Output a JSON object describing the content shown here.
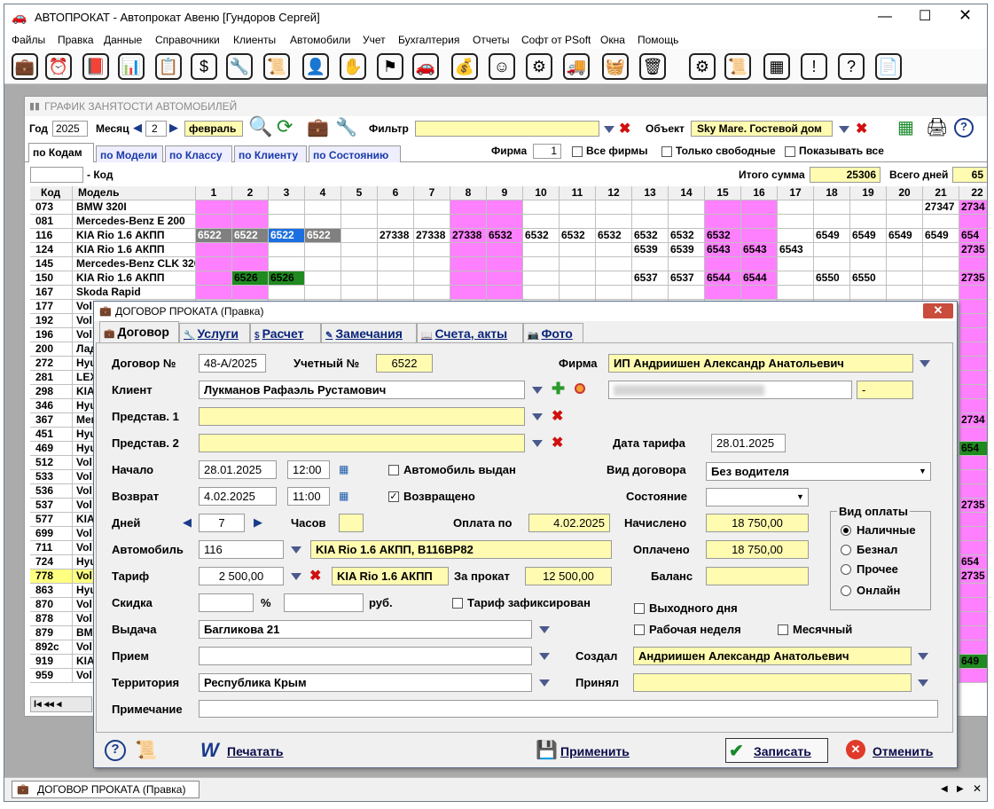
{
  "window": {
    "title": "АВТОПРОКАТ - Автопрокат Авеню  [Гундоров Сергей]"
  },
  "menu": [
    "Файлы",
    "Правка",
    "Данные",
    "Справочники",
    "Клиенты",
    "Автомобили",
    "Учет",
    "Бухгалтерия",
    "Отчеты",
    "Софт от PSoft",
    "Окна",
    "Помощь"
  ],
  "toolbar_icons": [
    "briefcase-icon",
    "alarm-clock-icon",
    "book-icon",
    "chart-icon",
    "clipboard-icon",
    "money-icon",
    "wrench-icon",
    "scroll-icon",
    "person-icon",
    "stop-hand-icon",
    "flag-icon",
    "car-icon",
    "money-bag-icon",
    "face-icon",
    "gear-icon",
    "truck-icon",
    "basket-icon",
    "trash-icon",
    "settings-doc-icon",
    "scroll2-icon",
    "calculator-icon",
    "warning-icon",
    "help-icon",
    "document-icon"
  ],
  "schedule": {
    "title": "ГРАФИК ЗАНЯТОСТИ АВТОМОБИЛЕЙ",
    "year_label": "Год",
    "year": "2025",
    "month_label": "Месяц",
    "month_num": "2",
    "month_name": "февраль",
    "filter_label": "Фильтр",
    "object_label": "Объект",
    "object": "Sky Mare. Гостевой дом",
    "tabs": [
      "по Кодам",
      "по Модели",
      "по Классу",
      "по Клиенту",
      "по Состоянию"
    ],
    "firm_label": "Фирма",
    "firm_value": "1",
    "all_firms": "Все фирмы",
    "only_free": "Только свободные",
    "show_all": "Показывать все",
    "code_label": "- Код",
    "total_sum_label": "Итого сумма",
    "total_sum": "25306",
    "total_days_label": "Всего дней",
    "total_days": "65",
    "col_code": "Код",
    "col_model": "Модель",
    "days": [
      "1",
      "2",
      "3",
      "4",
      "5",
      "6",
      "7",
      "8",
      "9",
      "10",
      "11",
      "12",
      "13",
      "14",
      "15",
      "16",
      "17",
      "18",
      "19",
      "20",
      "21",
      "22"
    ],
    "rows": [
      {
        "code": "073",
        "model": "BMW 320I"
      },
      {
        "code": "081",
        "model": "Mercedes-Benz E 200"
      },
      {
        "code": "116",
        "model": "KIA Rio 1.6 АКПП"
      },
      {
        "code": "124",
        "model": "KIA Rio 1.6 АКПП"
      },
      {
        "code": "145",
        "model": "Mercedes-Benz CLK 320"
      },
      {
        "code": "150",
        "model": "KIA Rio 1.6 АКПП"
      },
      {
        "code": "167",
        "model": "Skoda Rapid"
      },
      {
        "code": "177",
        "model": "Vol"
      },
      {
        "code": "192",
        "model": "Vol"
      },
      {
        "code": "196",
        "model": "Vol"
      },
      {
        "code": "200",
        "model": "Лад"
      },
      {
        "code": "272",
        "model": "Hyu"
      },
      {
        "code": "281",
        "model": "LEX"
      },
      {
        "code": "298",
        "model": "KIA"
      },
      {
        "code": "346",
        "model": "Hyu"
      },
      {
        "code": "367",
        "model": "Mer"
      },
      {
        "code": "451",
        "model": "Hyu"
      },
      {
        "code": "469",
        "model": "Hyu"
      },
      {
        "code": "512",
        "model": "Vol"
      },
      {
        "code": "533",
        "model": "Vol"
      },
      {
        "code": "536",
        "model": "Vol"
      },
      {
        "code": "537",
        "model": "Vol"
      },
      {
        "code": "577",
        "model": "KIA"
      },
      {
        "code": "699",
        "model": "Vol"
      },
      {
        "code": "711",
        "model": "Vol"
      },
      {
        "code": "724",
        "model": "Hyu"
      },
      {
        "code": "778",
        "model": "Vol"
      },
      {
        "code": "863",
        "model": "Hyu"
      },
      {
        "code": "870",
        "model": "Vol"
      },
      {
        "code": "878",
        "model": "Vol"
      },
      {
        "code": "879",
        "model": "BM"
      },
      {
        "code": "892c",
        "model": "Vol"
      },
      {
        "code": "919",
        "model": "KIA"
      },
      {
        "code": "959",
        "model": "Vol"
      }
    ],
    "cells": {
      "r0": {
        "21": "27347",
        "22": "2734"
      },
      "r2": {
        "1": "6522",
        "2": "6522",
        "3": "6522",
        "4": "6522",
        "6": "27338",
        "7": "27338",
        "8": "27338",
        "9": "6532",
        "10": "6532",
        "11": "6532",
        "12": "6532",
        "13": "6532",
        "14": "6532",
        "15": "6532",
        "18": "6549",
        "19": "6549",
        "20": "6549",
        "21": "6549",
        "22": "654"
      },
      "r3": {
        "13": "6539",
        "14": "6539",
        "15": "6543",
        "16": "6543",
        "17": "6543",
        "22": "2735"
      },
      "r5": {
        "2": "6526",
        "3": "6526",
        "13": "6537",
        "14": "6537",
        "15": "6544",
        "16": "6544",
        "18": "6550",
        "19": "6550",
        "22": "2735"
      },
      "right": {
        "r15": "2734",
        "r17": "654",
        "r21": "2735",
        "r25": "654",
        "r26": "2735",
        "r32": "649"
      }
    },
    "nav": "I◂ ◂◂ ◂"
  },
  "dialog": {
    "title": "ДОГОВОР ПРОКАТА (Правка)",
    "tabs": [
      "Договор",
      "Услуги",
      "Расчет",
      "Замечания",
      "Счета, акты",
      "Фото"
    ],
    "contract_no_label": "Договор №",
    "contract_no": "48-А/2025",
    "acc_no_label": "Учетный №",
    "acc_no": "6522",
    "firm_label": "Фирма",
    "firm": "ИП Андриишен Александр Анатольевич",
    "client_label": "Клиент",
    "client": "Лукманов Рафаэль Рустамович",
    "client_extra": "-",
    "rep1_label": "Представ. 1",
    "rep2_label": "Представ. 2",
    "tariff_date_label": "Дата тарифа",
    "tariff_date": "28.01.2025",
    "start_label": "Начало",
    "start_date": "28.01.2025",
    "start_time": "12:00",
    "car_issued": "Автомобиль выдан",
    "contract_type_label": "Вид договора",
    "contract_type": "Без водителя",
    "return_label": "Возврат",
    "return_date": "4.02.2025",
    "return_time": "11:00",
    "returned": "Возвращено",
    "state_label": "Состояние",
    "days_label": "Дней",
    "days": "7",
    "hours_label": "Часов",
    "paid_until_label": "Оплата по",
    "paid_until": "4.02.2025",
    "charged_label": "Начислено",
    "charged": "18 750,00",
    "paid_label": "Оплачено",
    "paid": "18 750,00",
    "balance_label": "Баланс",
    "car_label": "Автомобиль",
    "car_code": "116",
    "car_name": "KIA Rio 1.6 АКПП, В116ВР82",
    "tariff_label": "Тариф",
    "tariff": "2 500,00",
    "tariff_name": "KIA Rio 1.6 АКПП",
    "rent_label": "За прокат",
    "rent": "12 500,00",
    "discount_label": "Скидка",
    "percent": "%",
    "rub": "руб.",
    "tariff_fixed": "Тариф зафиксирован",
    "day_off": "Выходного дня",
    "work_week": "Рабочая неделя",
    "monthly": "Месячный",
    "pay_type_label": "Вид оплаты",
    "pay_types": [
      "Наличные",
      "Безнал",
      "Прочее",
      "Онлайн"
    ],
    "issue_label": "Выдача",
    "issue": "Багликова 21",
    "receive_label": "Прием",
    "created_label": "Создал",
    "created": "Андриишен Александр Анатольевич",
    "accepted_label": "Принял",
    "territory_label": "Территория",
    "territory": "Республика Крым",
    "note_label": "Примечание",
    "print": "Печатать",
    "apply": "Применить",
    "save": "Записать",
    "cancel": "Отменить"
  },
  "taskbar": {
    "item": "ДОГОВОР ПРОКАТА (Правка)"
  }
}
